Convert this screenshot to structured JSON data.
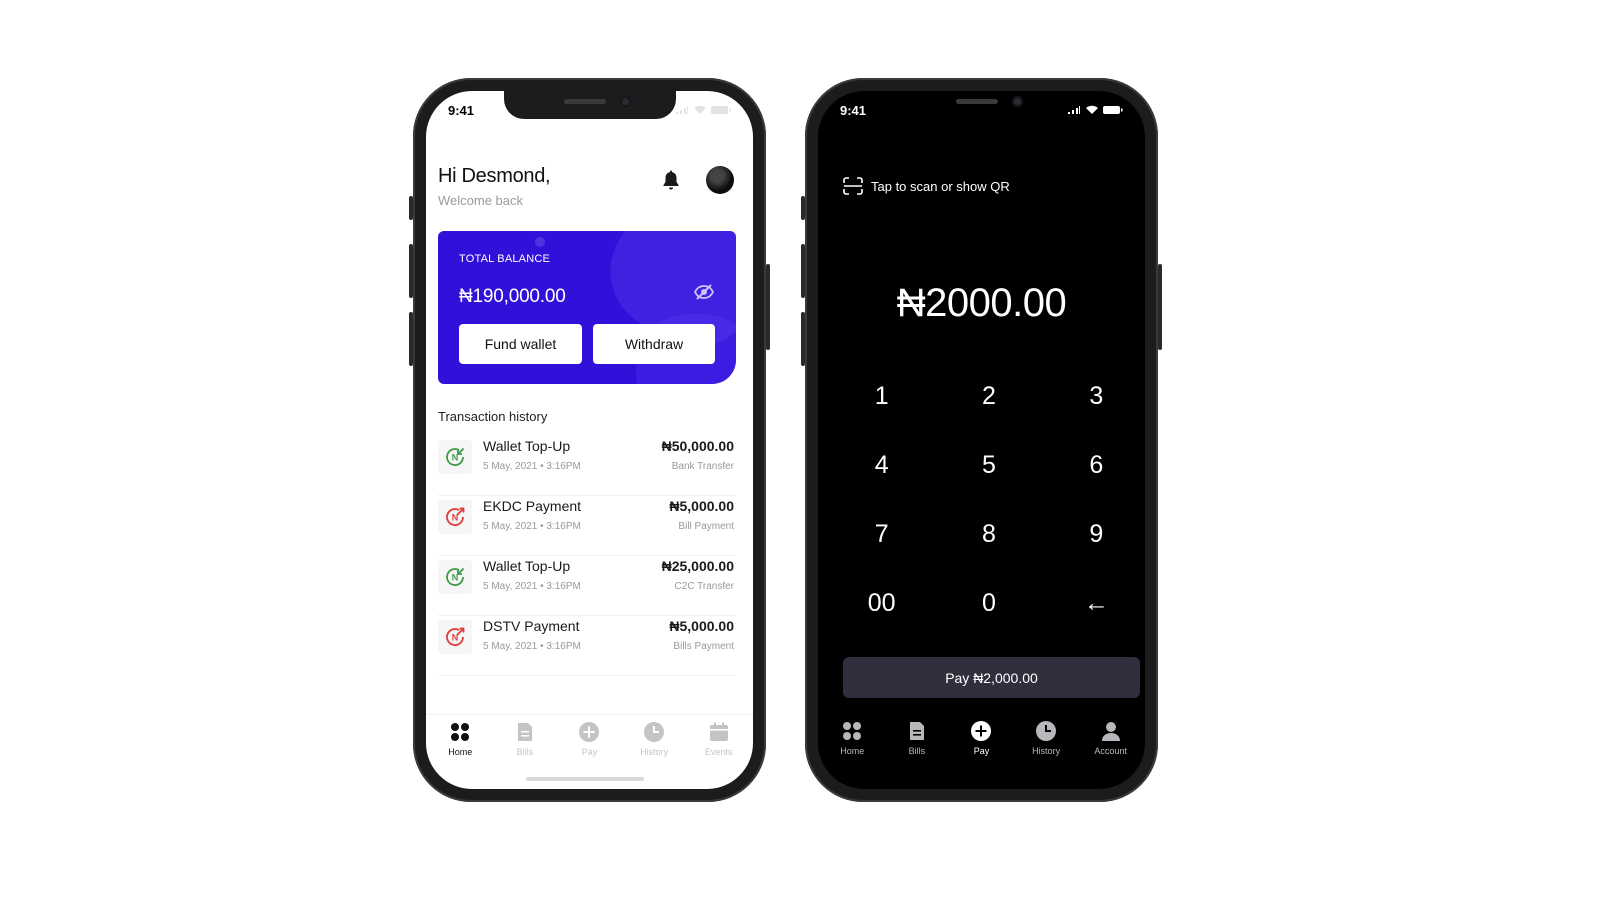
{
  "colors": {
    "brand_purple": "#3210d9",
    "credit_green": "#3f9a4b",
    "debit_red": "#e0393b",
    "pay_button": "#2f2f3d"
  },
  "left_phone": {
    "status": {
      "time": "9:41"
    },
    "header": {
      "greeting": "Hi Desmond,",
      "subtitle": "Welcome back",
      "bell_icon": "bell-icon",
      "avatar_icon": "avatar"
    },
    "balance_card": {
      "label": "TOTAL BALANCE",
      "amount": "₦190,000.00",
      "hide_icon": "eye-off-icon",
      "fund_label": "Fund wallet",
      "withdraw_label": "Withdraw"
    },
    "transactions": {
      "title": "Transaction history",
      "items": [
        {
          "name": "Wallet Top-Up",
          "date": "5 May, 2021 • 3:16PM",
          "amount": "₦50,000.00",
          "method": "Bank Transfer",
          "type": "credit"
        },
        {
          "name": "EKDC Payment",
          "date": "5 May, 2021 • 3:16PM",
          "amount": "₦5,000.00",
          "method": "Bill Payment",
          "type": "debit"
        },
        {
          "name": "Wallet Top-Up",
          "date": "5 May, 2021 • 3:16PM",
          "amount": "₦25,000.00",
          "method": "C2C Transfer",
          "type": "credit"
        },
        {
          "name": "DSTV Payment",
          "date": "5 May, 2021 • 3:16PM",
          "amount": "₦5,000.00",
          "method": "Bills Payment",
          "type": "debit"
        }
      ]
    },
    "nav": {
      "active": "Home",
      "items": [
        {
          "label": "Home",
          "icon": "home-grid-icon"
        },
        {
          "label": "Bills",
          "icon": "bills-document-icon"
        },
        {
          "label": "Pay",
          "icon": "pay-plus-icon"
        },
        {
          "label": "History",
          "icon": "history-clock-icon"
        },
        {
          "label": "Events",
          "icon": "events-calendar-icon"
        }
      ]
    }
  },
  "right_phone": {
    "status": {
      "time": "9:41"
    },
    "scan": {
      "label": "Tap to scan or show QR",
      "icon": "qr-scan-icon"
    },
    "amount": "₦2000.00",
    "keypad": [
      "1",
      "2",
      "3",
      "4",
      "5",
      "6",
      "7",
      "8",
      "9",
      "00",
      "0",
      "←"
    ],
    "pay_button": "Pay ₦2,000.00",
    "nav": {
      "active": "Pay",
      "items": [
        {
          "label": "Home",
          "icon": "home-grid-icon"
        },
        {
          "label": "Bills",
          "icon": "bills-document-icon"
        },
        {
          "label": "Pay",
          "icon": "pay-plus-icon"
        },
        {
          "label": "History",
          "icon": "history-clock-icon"
        },
        {
          "label": "Account",
          "icon": "account-user-icon"
        }
      ]
    }
  }
}
